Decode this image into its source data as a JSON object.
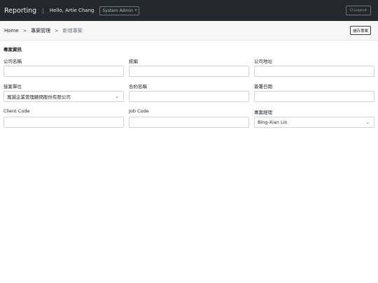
{
  "navbar": {
    "brand": "Reporting",
    "separator": "|",
    "greeting": "Hello, Artie Chang",
    "role": "System Admin",
    "logout": "Logout"
  },
  "breadcrumb": {
    "home": "Home",
    "gt": ">",
    "level2": "專案管理",
    "current": "新增專案"
  },
  "save_button": "儲存專案",
  "section_title": "專案資訊",
  "fields": {
    "company_name": {
      "label": "公司名稱",
      "value": ""
    },
    "tax_id": {
      "label": "統編",
      "value": ""
    },
    "company_address": {
      "label": "公司地址",
      "value": ""
    },
    "undertaking_unit": {
      "label": "接案單位",
      "value": "寬誠企業管理顧問股份有限公司"
    },
    "contract_name": {
      "label": "合約名稱",
      "value": ""
    },
    "sign_date": {
      "label": "簽署日期",
      "value": ""
    },
    "client_code": {
      "label": "Client Code",
      "value": ""
    },
    "job_code": {
      "label": "Job Code",
      "value": ""
    },
    "project_manager": {
      "label": "專案經理",
      "value": "Bing-Xian Lin"
    }
  },
  "icons": {
    "chevron_down": "⌄",
    "power": "⏻"
  }
}
